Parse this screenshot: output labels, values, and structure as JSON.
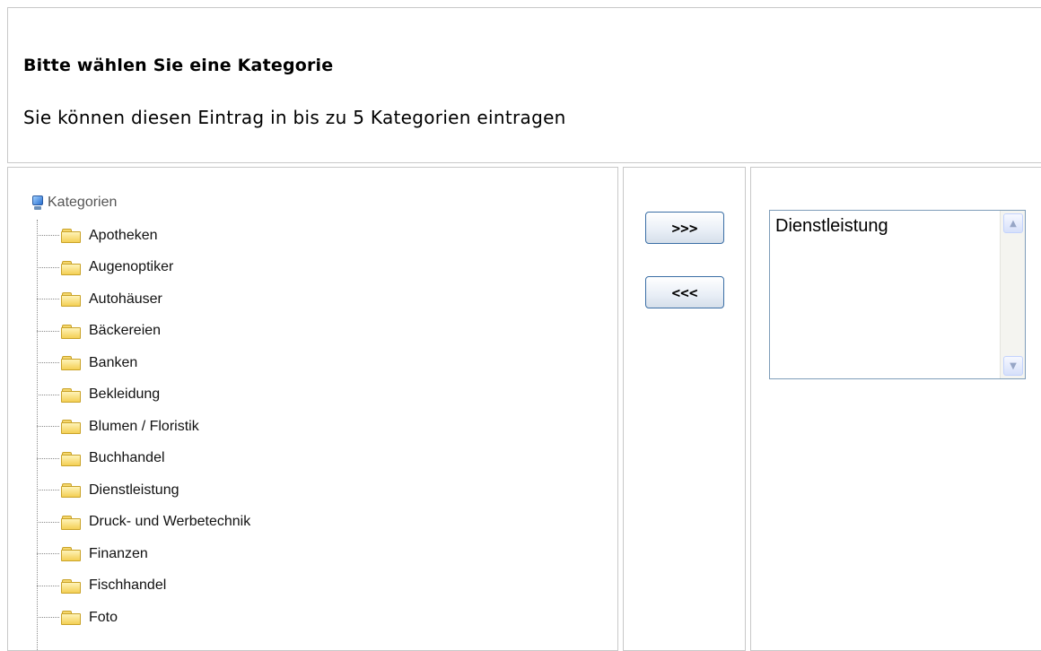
{
  "header": {
    "title": "Bitte wählen Sie eine Kategorie",
    "description": "Sie können diesen Eintrag in bis zu 5 Kategorien eintragen"
  },
  "tree": {
    "root_label": "Kategorien",
    "items": [
      {
        "label": "Apotheken"
      },
      {
        "label": "Augenoptiker"
      },
      {
        "label": "Autohäuser"
      },
      {
        "label": "Bäckereien"
      },
      {
        "label": "Banken"
      },
      {
        "label": "Bekleidung"
      },
      {
        "label": "Blumen / Floristik"
      },
      {
        "label": "Buchhandel"
      },
      {
        "label": "Dienstleistung"
      },
      {
        "label": "Druck- und Werbetechnik"
      },
      {
        "label": "Finanzen"
      },
      {
        "label": "Fischhandel"
      },
      {
        "label": "Foto"
      }
    ]
  },
  "buttons": {
    "add_label": ">>>",
    "remove_label": "<<<"
  },
  "selected": {
    "items": [
      "Dienstleistung"
    ]
  },
  "icons": {
    "root": "computer-icon",
    "item": "folder-icon",
    "scroll_up": "arrow-up-icon",
    "scroll_down": "arrow-down-icon"
  }
}
